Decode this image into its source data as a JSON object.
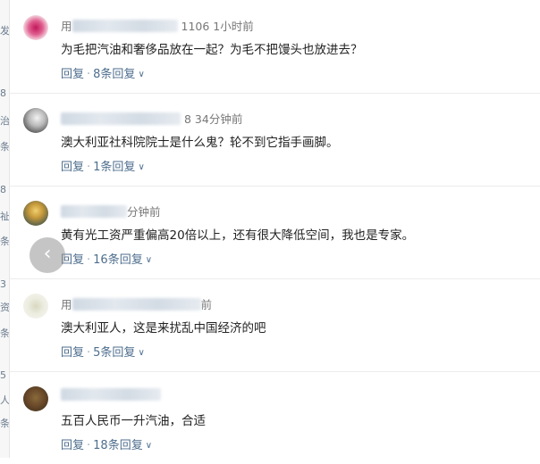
{
  "left_strip_chars": [
    "发",
    "8",
    "治",
    "条",
    "8",
    "祉",
    "条",
    "3",
    "资",
    "条",
    "5",
    "人",
    "条"
  ],
  "comments": [
    {
      "name_prefix": "用",
      "time": "1106 1小时前",
      "text": "为毛把汽油和奢侈品放在一起？为毛不把馒头也放进去？",
      "reply_label": "回复",
      "replies_label": "8条回复"
    },
    {
      "name_prefix": "",
      "time": "8 34分钟前",
      "text": "澳大利亚社科院院士是什么鬼？轮不到它指手画脚。",
      "reply_label": "回复",
      "replies_label": "1条回复"
    },
    {
      "name_prefix": "",
      "time": "分钟前",
      "text": "黄有光工资严重偏高20倍以上，还有很大降低空间，我也是专家。",
      "reply_label": "回复",
      "replies_label": "16条回复"
    },
    {
      "name_prefix": "用",
      "time": "前",
      "text": "澳大利亚人，这是来扰乱中国经济的吧",
      "reply_label": "回复",
      "replies_label": "5条回复"
    },
    {
      "name_prefix": "",
      "time": "",
      "text": "五百人民币一升汽油，合适",
      "reply_label": "回复",
      "replies_label": "18条回复"
    }
  ],
  "nav": {
    "prev_glyph": "‹"
  }
}
